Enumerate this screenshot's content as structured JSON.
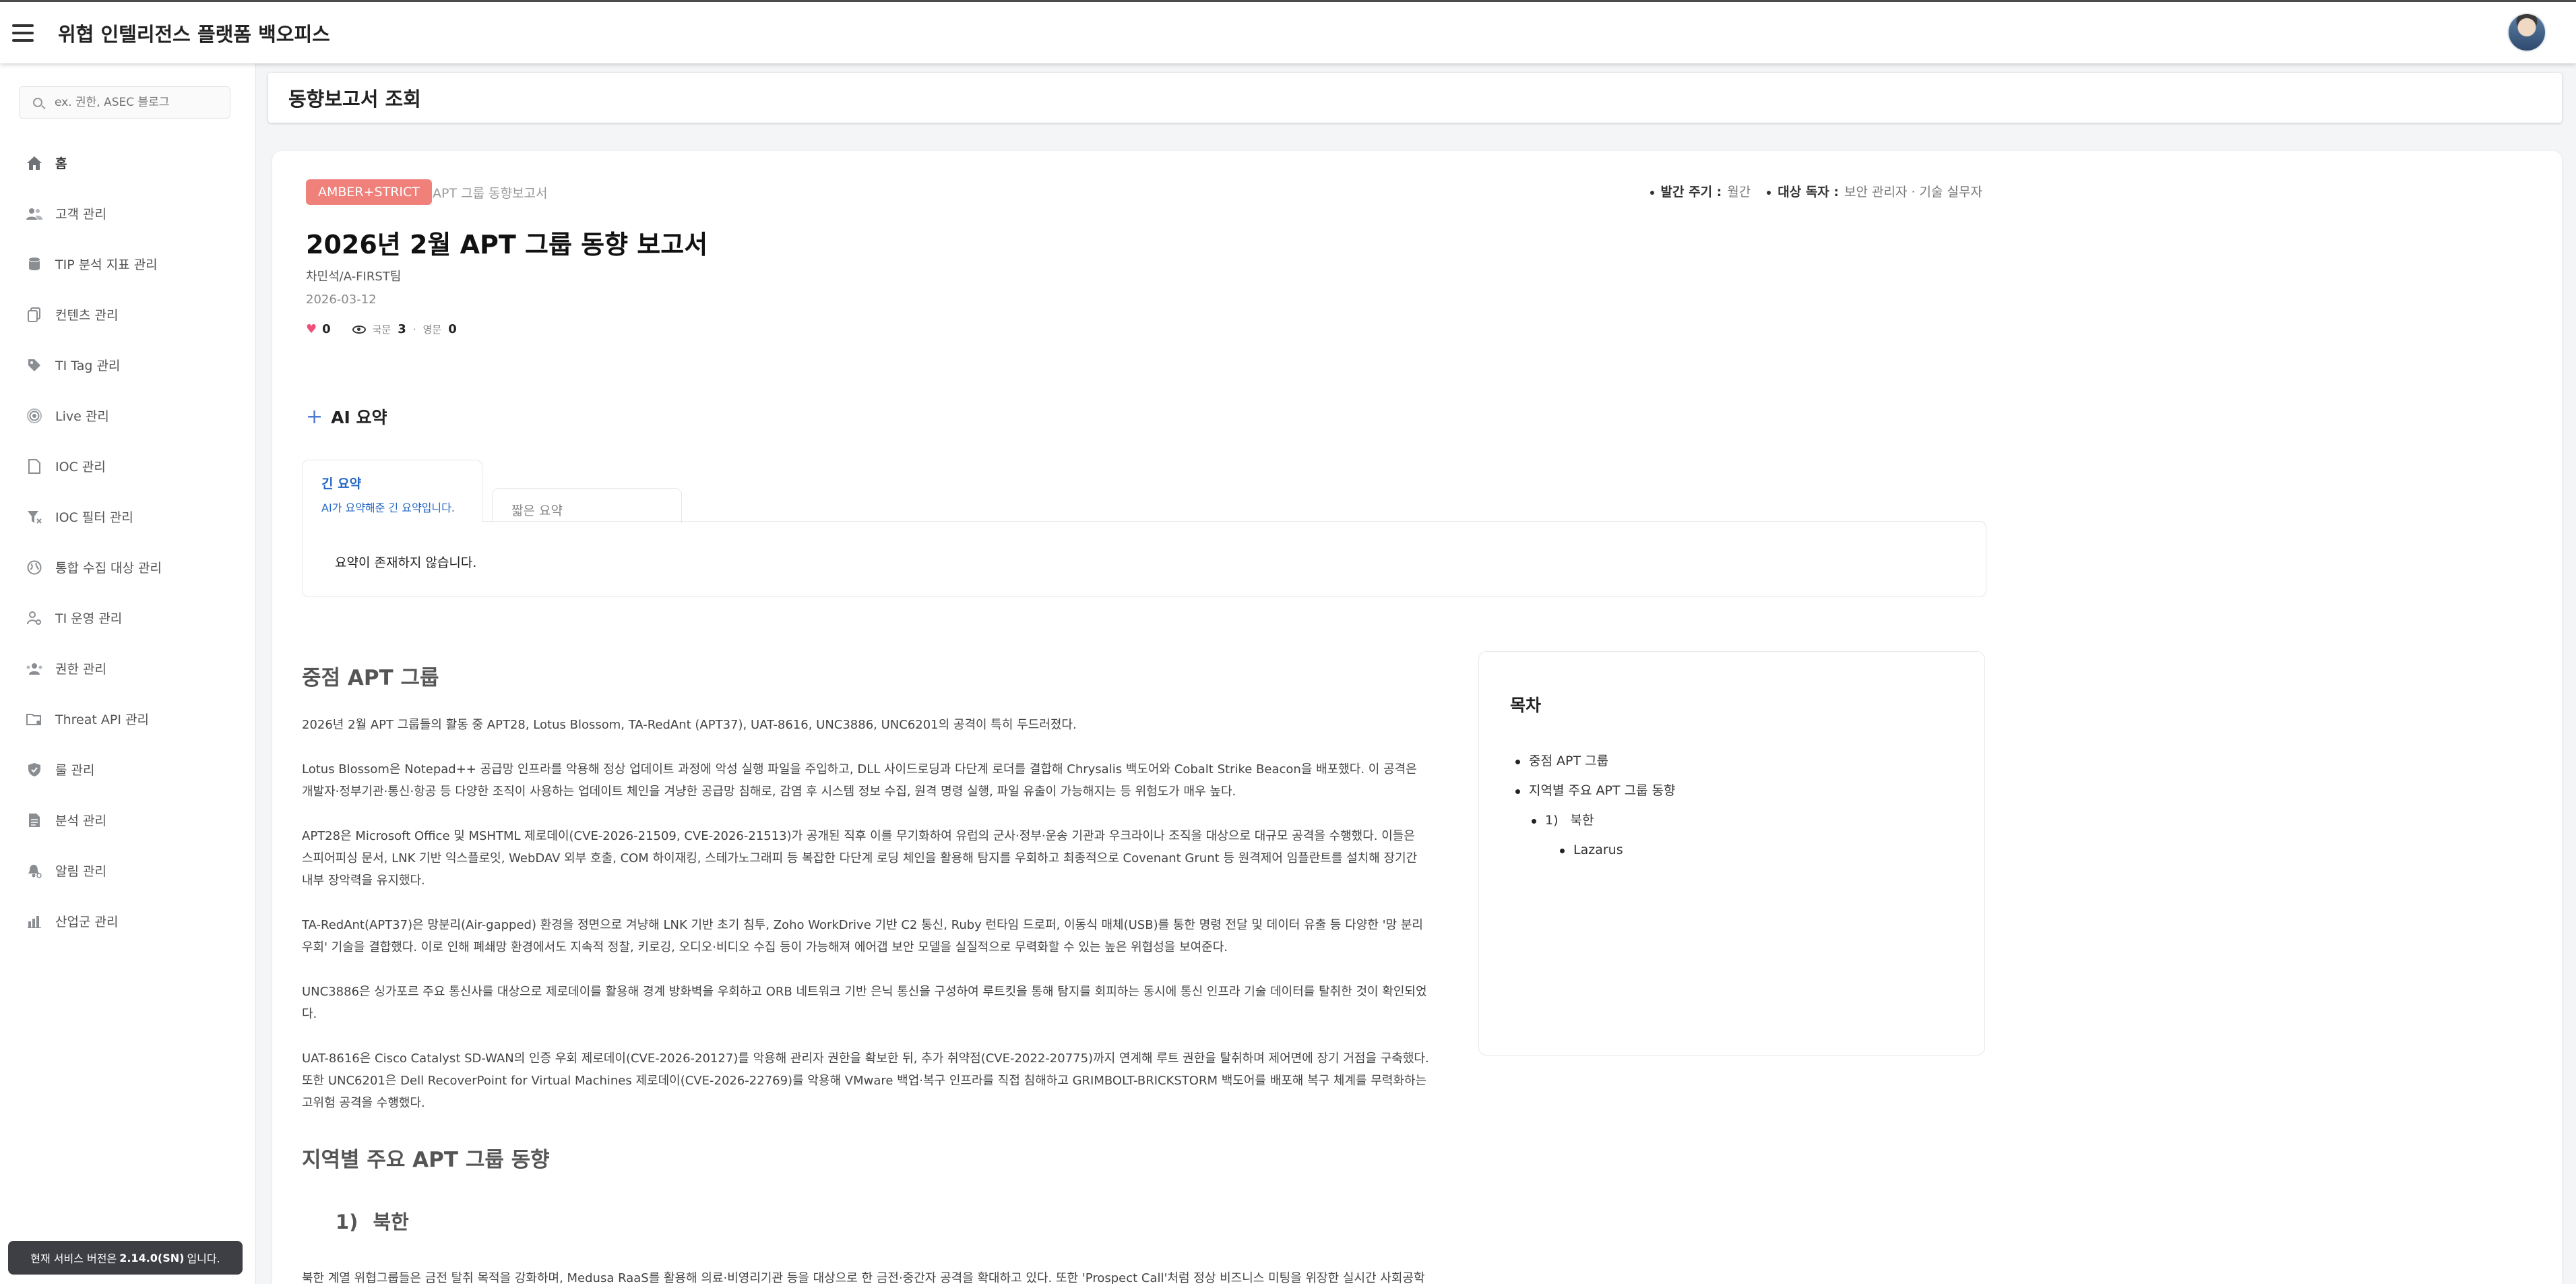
{
  "app": {
    "title": "위협 인텔리전스 플랫폼 백오피스"
  },
  "sidebar": {
    "search_placeholder": "ex. 권한, ASEC 블로그",
    "items": [
      {
        "label": "홈",
        "icon": "home-icon"
      },
      {
        "label": "고객 관리",
        "icon": "users-icon"
      },
      {
        "label": "TIP 분석 지표 관리",
        "icon": "database-icon"
      },
      {
        "label": "컨텐츠 관리",
        "icon": "copy-icon"
      },
      {
        "label": "TI Tag 관리",
        "icon": "tag-icon"
      },
      {
        "label": "Live 관리",
        "icon": "broadcast-icon"
      },
      {
        "label": "IOC 관리",
        "icon": "file-icon"
      },
      {
        "label": "IOC 필터 관리",
        "icon": "filter-icon"
      },
      {
        "label": "통합 수집 대상 관리",
        "icon": "globe-icon"
      },
      {
        "label": "TI 운영 관리",
        "icon": "user-gear-icon"
      },
      {
        "label": "권한 관리",
        "icon": "user-group-icon"
      },
      {
        "label": "Threat API 관리",
        "icon": "api-folder-icon"
      },
      {
        "label": "룰 관리",
        "icon": "shield-icon"
      },
      {
        "label": "분석 관리",
        "icon": "document-icon"
      },
      {
        "label": "알림 관리",
        "icon": "bell-icon"
      },
      {
        "label": "산업군 관리",
        "icon": "bar-chart-icon"
      }
    ],
    "version": {
      "prefix": "현재 서비스 버전은",
      "value": "2.14.0(SN)",
      "suffix": "입니다."
    }
  },
  "page": {
    "title": "동향보고서 조회"
  },
  "report": {
    "badge": "AMBER+STRICT",
    "category": "APT 그룹 동향보고서",
    "cycle_label": "발간 주기 :",
    "cycle": "월간",
    "audience_label": "대상 독자 :",
    "audience": "보안 관리자 · 기술 실무자",
    "title": "2026년 2월 APT 그룹 동향 보고서",
    "author": "차민석/A-FIRST팀",
    "date": "2026-03-12",
    "likes": "0",
    "views_domestic_label": "국문",
    "views_domestic": "3",
    "views_english_label": "영문",
    "views_english": "0"
  },
  "ai_summary": {
    "title": "AI 요약",
    "tab_long": "긴 요약",
    "tab_long_desc": "AI가 요약해준 긴 요약입니다.",
    "tab_short": "짧은 요약",
    "empty": "요약이 존재하지 않습니다."
  },
  "content": {
    "h_focus": "중점 APT 그룹",
    "p1": "2026년 2월 APT 그룹들의 활동 중 APT28, Lotus Blossom, TA-RedAnt (APT37), UAT-8616, UNC3886, UNC6201의 공격이 특히 두드러졌다.",
    "p2": "Lotus Blossom은 Notepad++ 공급망 인프라를 악용해 정상 업데이트 과정에 악성 실행 파일을 주입하고, DLL 사이드로딩과 다단계 로더를 결합해 Chrysalis 백도어와 Cobalt Strike Beacon을 배포했다. 이 공격은 개발자·정부기관·통신·항공 등 다양한 조직이 사용하는 업데이트 체인을 겨냥한 공급망 침해로, 감염 후 시스템 정보 수집, 원격 명령 실행, 파일 유출이 가능해지는 등 위험도가 매우 높다.",
    "p3": "APT28은 Microsoft Office 및 MSHTML 제로데이(CVE-2026-21509, CVE-2026-21513)가 공개된 직후 이를 무기화하여 유럽의 군사·정부·운송 기관과 우크라이나 조직을 대상으로 대규모 공격을 수행했다. 이들은 스피어피싱 문서, LNK 기반 익스플로잇, WebDAV 외부 호출, COM 하이재킹, 스테가노그래피 등 복잡한 다단계 로딩 체인을 활용해 탐지를 우회하고 최종적으로 Covenant Grunt 등 원격제어 임플란트를 설치해 장기간 내부 장악력을 유지했다.",
    "p4": "TA-RedAnt(APT37)은 망분리(Air-gapped) 환경을 정면으로 겨냥해 LNK 기반 초기 침투, Zoho WorkDrive 기반 C2 통신, Ruby 런타임 드로퍼, 이동식 매체(USB)를 통한 명령 전달 및 데이터 유출 등 다양한 '망 분리 우회' 기술을 결합했다. 이로 인해 폐쇄망 환경에서도 지속적 정찰, 키로깅, 오디오·비디오 수집 등이 가능해져 에어갭 보안 모델을 실질적으로 무력화할 수 있는 높은 위협성을 보여준다.",
    "p5": "UNC3886은 싱가포르 주요 통신사를 대상으로 제로데이를 활용해 경계 방화벽을 우회하고 ORB 네트워크 기반 은닉 통신을 구성하여 루트킷을 통해 탐지를 회피하는 동시에 통신 인프라 기술 데이터를 탈취한 것이 확인되었다.",
    "p6": "UAT-8616은 Cisco Catalyst SD-WAN의 인증 우회 제로데이(CVE-2026-20127)를 악용해 관리자 권한을 확보한 뒤, 추가 취약점(CVE-2022-20775)까지 연계해 루트 권한을 탈취하며 제어면에 장기 거점을 구축했다. 또한 UNC6201은 Dell RecoverPoint for Virtual Machines 제로데이(CVE-2026-22769)를 악용해 VMware 백업·복구 인프라를 직접 침해하고 GRIMBOLT-BRICKSTORM 백도어를 배포해 복구 체계를 무력화하는 고위험 공격을 수행했다.",
    "h_region": "지역별 주요 APT 그룹 동향",
    "h_nk_num": "1)",
    "h_nk": "북한",
    "p7": "북한 계열 위협그룹들은 금전 탈취 목적을 강화하며, Medusa RaaS를 활용해 의료·비영리기관 등을 대상으로 한 금전·중간자 공격을 확대하고 있다. 또한 'Prospect Call'처럼 정상 비즈니스 미팅을 위장한 실시간 사회공학 기법을 활용해 macOS 자격 증명을 직접 탈취하는 고도화된 상호작용형 공격을 시도하고 있다. 이와 병행해 UNC1069는 딥페이크 영상·가짜 Zoom 회의·ClickFix 기반 명령 실행 등 AI·미"
  },
  "toc": {
    "title": "목차",
    "items": [
      {
        "label": "중점 APT 그룹",
        "level": 1
      },
      {
        "label": "지역별 주요 APT 그룹 동향",
        "level": 1
      },
      {
        "num": "1)",
        "label": "북한",
        "level": 2
      },
      {
        "label": "Lazarus",
        "level": 3
      }
    ]
  }
}
